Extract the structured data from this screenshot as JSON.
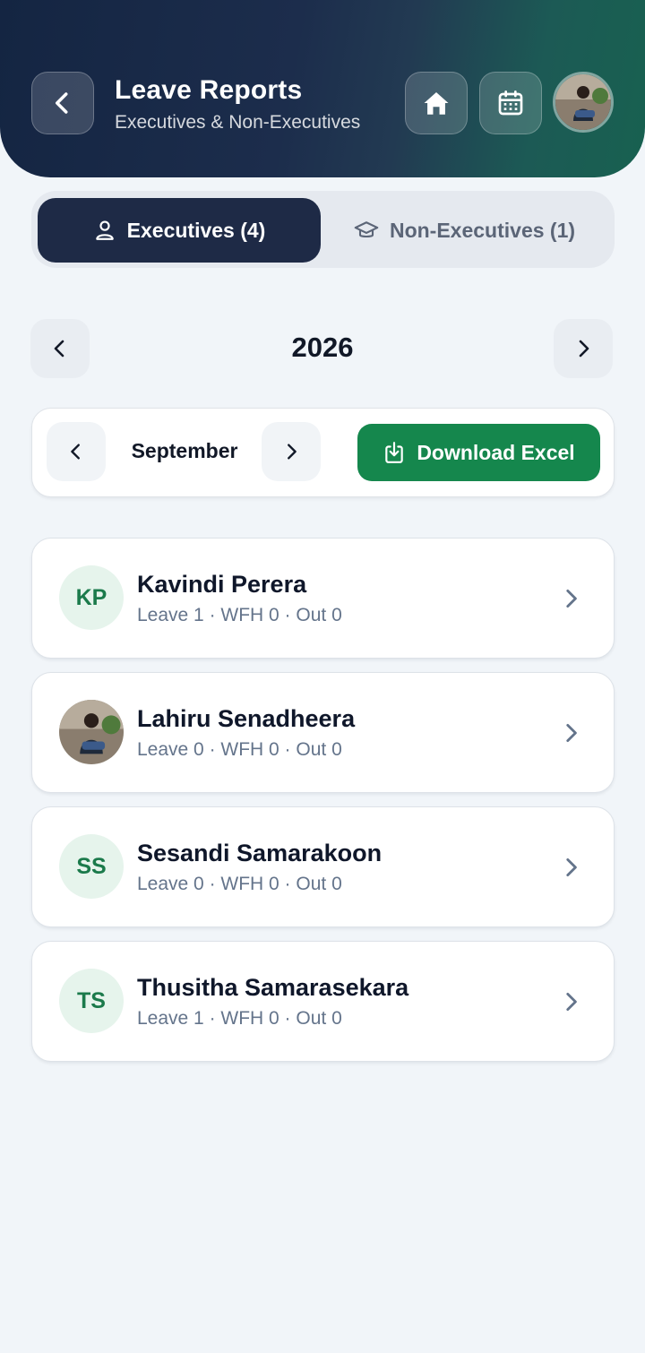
{
  "header": {
    "title": "Leave Reports",
    "subtitle": "Executives & Non-Executives"
  },
  "tabs": [
    {
      "label": "Executives (4)",
      "icon": "person-icon",
      "active": true
    },
    {
      "label": "Non-Executives (1)",
      "icon": "graduation-cap-icon",
      "active": false
    }
  ],
  "year": "2026",
  "month": "September",
  "download_label": "Download Excel",
  "colors": {
    "header_start": "#142542",
    "header_end": "#186150",
    "active_tab": "#1e2a46",
    "download": "#15874d",
    "initials": "#1b7a4b"
  },
  "employees": [
    {
      "name": "Kavindi Perera",
      "initials": "KP",
      "stats": "Leave 1 · WFH 0 · Out 0",
      "photo": false
    },
    {
      "name": "Lahiru Senadheera",
      "initials": "",
      "stats": "Leave 0 · WFH 0 · Out 0",
      "photo": true
    },
    {
      "name": "Sesandi Samarakoon",
      "initials": "SS",
      "stats": "Leave 0 · WFH 0 · Out 0",
      "photo": false
    },
    {
      "name": "Thusitha Samarasekara",
      "initials": "TS",
      "stats": "Leave 1 · WFH 0 · Out 0",
      "photo": false
    }
  ]
}
